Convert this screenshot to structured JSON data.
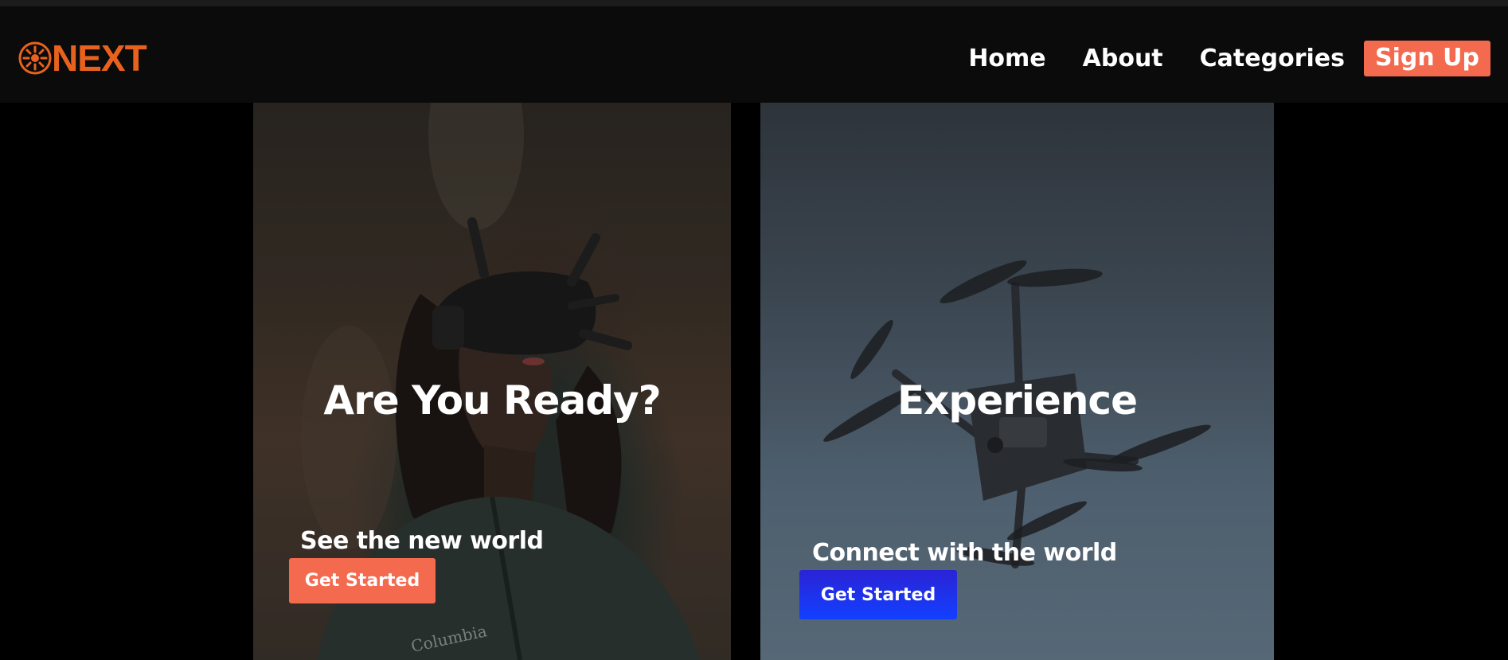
{
  "brand": {
    "logo_text": "NEXT",
    "logo_icon": "sun-emblem-icon",
    "accent_color": "#e8621d"
  },
  "nav": {
    "links": [
      "Home",
      "About",
      "Categories"
    ],
    "signup_label": "Sign Up",
    "signup_color": "#f36a4e"
  },
  "cards": [
    {
      "title": "Are You Ready?",
      "subtitle": "See the new world",
      "cta_label": "Get Started",
      "cta_color": "#f36a4e",
      "image": "person-wearing-fpv-goggles"
    },
    {
      "title": "Experience",
      "subtitle": "Connect with the world",
      "cta_label": "Get Started",
      "cta_color": "#1a33f0",
      "image": "drone-in-flight"
    }
  ]
}
